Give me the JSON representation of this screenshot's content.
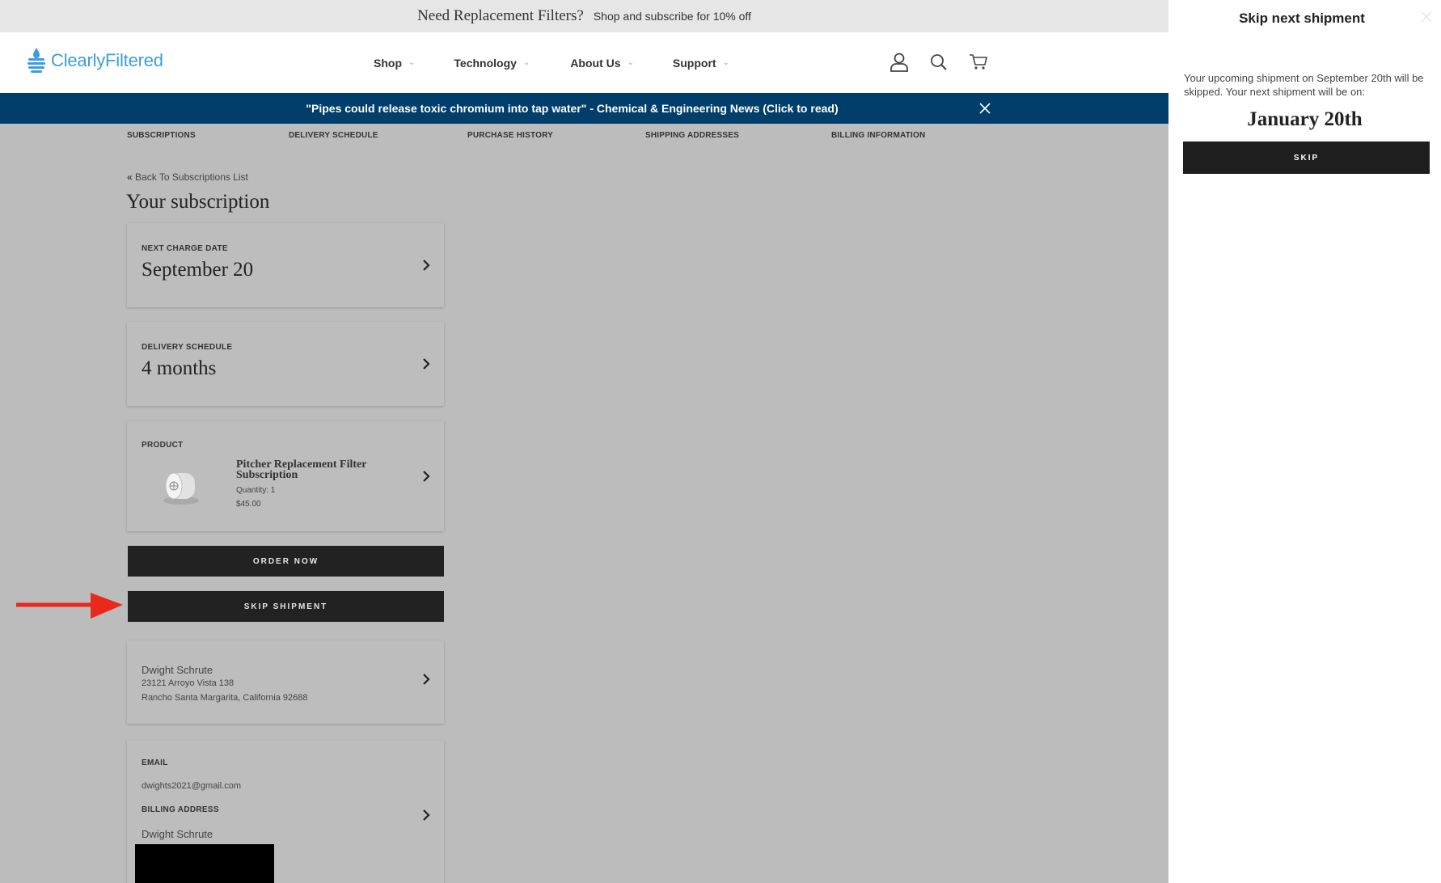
{
  "promo": {
    "title": "Need Replacement Filters?",
    "subtitle": "Shop and subscribe for 10% off"
  },
  "header": {
    "logo_text": "ClearlyFiltered",
    "nav": [
      {
        "label": "Shop",
        "icon": "chevron-down-icon"
      },
      {
        "label": "Technology",
        "icon": "chevron-down-icon"
      },
      {
        "label": "About Us",
        "icon": "chevron-down-icon"
      },
      {
        "label": "Support",
        "icon": "chevron-down-icon"
      }
    ],
    "icons": [
      "account-icon",
      "search-icon",
      "cart-icon"
    ]
  },
  "news": {
    "text": "\"Pipes could release toxic chromium into tap water\" - Chemical & Engineering News (Click to read)"
  },
  "account_tabs": [
    "SUBSCRIPTIONS",
    "DELIVERY SCHEDULE",
    "PURCHASE HISTORY",
    "SHIPPING ADDRESSES",
    "BILLING INFORMATION"
  ],
  "subscription": {
    "back_link": "Back To Subscriptions List",
    "title": "Your subscription",
    "next_charge": {
      "label": "NEXT CHARGE DATE",
      "value": "September 20"
    },
    "delivery": {
      "label": "DELIVERY SCHEDULE",
      "value": "4 months"
    },
    "product": {
      "label": "PRODUCT",
      "name": "Pitcher Replacement Filter Subscription",
      "quantity": "Quantity: 1",
      "price": "$45.00"
    },
    "buttons": {
      "order_now": "ORDER NOW",
      "skip_shipment": "SKIP SHIPMENT"
    },
    "shipping": {
      "name": "Dwight Schrute",
      "street": "23121 Arroyo Vista 138",
      "city": "Rancho Santa Margarita, California 92688"
    },
    "billing": {
      "email_label": "EMAIL",
      "email": "dwights2021@gmail.com",
      "billing_label": "BILLING ADDRESS",
      "name": "Dwight Schrute"
    }
  },
  "drawer": {
    "title": "Skip next shipment",
    "message": "Your upcoming shipment on September 20th will be skipped. Your next shipment will be on:",
    "next_date": "January 20th",
    "skip_label": "SKIP"
  },
  "colors": {
    "brand_blue": "#3a9fd9",
    "news_bar": "#003e6b",
    "button_dark": "#222222",
    "annotation_arrow": "#e8291c",
    "overlay_gray": "#bcbcbc"
  }
}
